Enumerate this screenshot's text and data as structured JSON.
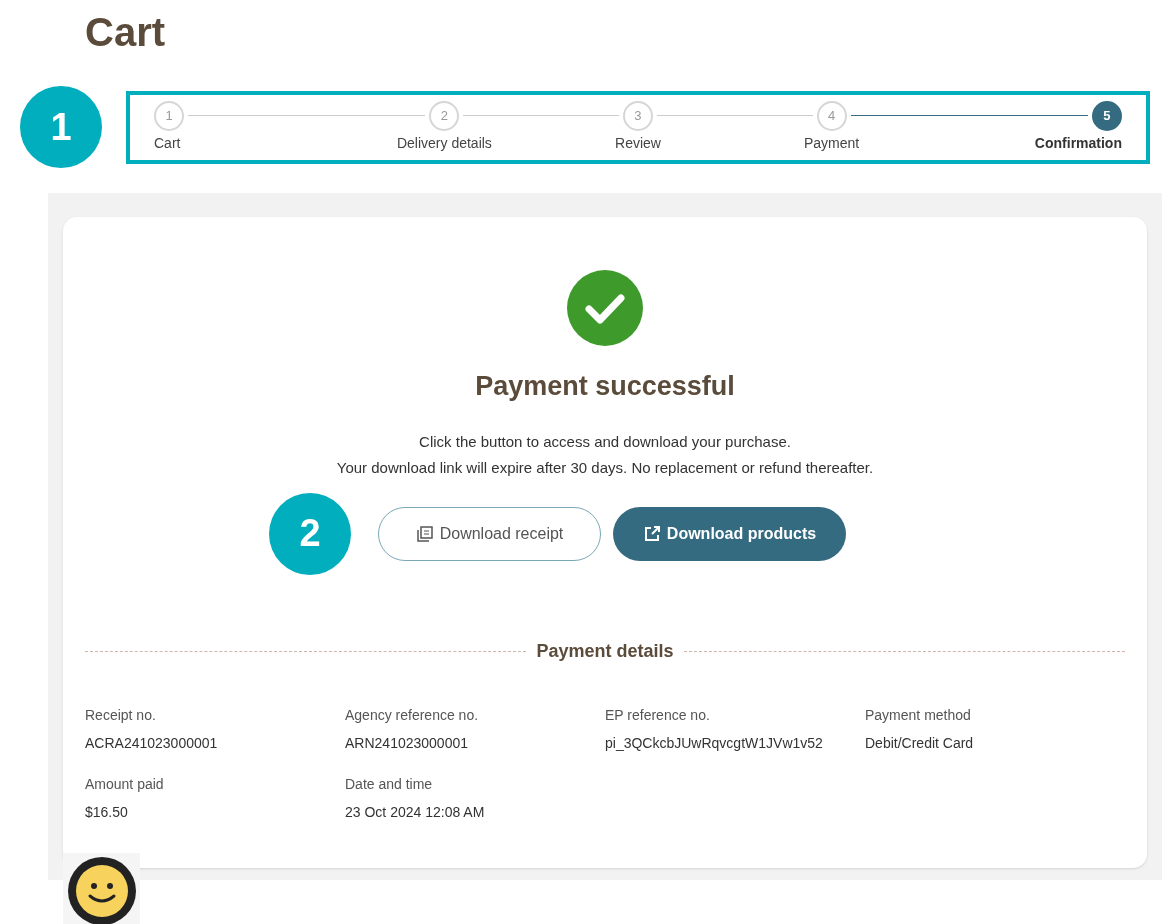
{
  "page_title": "Cart",
  "stepper": {
    "callout": "1",
    "steps": [
      {
        "number": "1",
        "label": "Cart",
        "selected": false
      },
      {
        "number": "2",
        "label": "Delivery details",
        "selected": false
      },
      {
        "number": "3",
        "label": "Review",
        "selected": false
      },
      {
        "number": "4",
        "label": "Payment",
        "selected": false
      },
      {
        "number": "5",
        "label": "Confirmation",
        "selected": true
      }
    ]
  },
  "confirmation": {
    "heading": "Payment successful",
    "message_lines": [
      "Click the button to access and download your purchase.",
      "Your download link will expire after 30 days. No replacement or refund thereafter."
    ],
    "callout": "2",
    "buttons": [
      {
        "label": "Download receipt",
        "kind": "outline"
      },
      {
        "label": "Download products",
        "kind": "primary"
      }
    ],
    "details_title": "Payment details",
    "details": [
      {
        "label": "Receipt no.",
        "value": "ACRA241023000001"
      },
      {
        "label": "Agency reference no.",
        "value": "ARN241023000001"
      },
      {
        "label": "EP reference no.",
        "value": "pi_3QCkcbJUwRqvcgtW1JVw1v52"
      },
      {
        "label": "Payment method",
        "value": "Debit/Credit Card"
      },
      {
        "label": "Amount paid",
        "value": "$16.50"
      },
      {
        "label": "Date and time",
        "value": "23 Oct 2024 12:08 AM"
      }
    ]
  }
}
